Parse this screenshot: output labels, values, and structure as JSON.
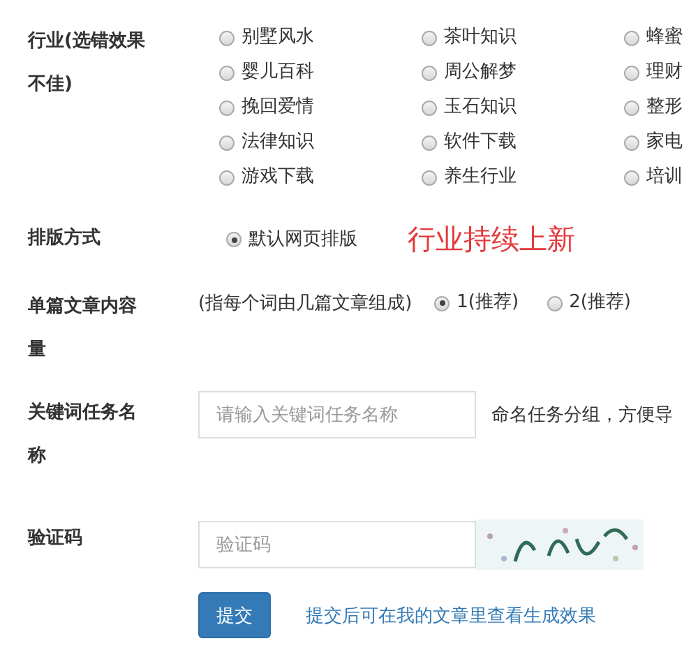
{
  "form": {
    "fields": [
      {
        "kind": "radio_grid",
        "label": "行业(选错效果不佳)",
        "options": [
          {
            "label": "别墅风水",
            "selected": false
          },
          {
            "label": "茶叶知识",
            "selected": false
          },
          {
            "label": "蜂蜜",
            "selected": false
          },
          {
            "label": "婴儿百科",
            "selected": false
          },
          {
            "label": "周公解梦",
            "selected": false
          },
          {
            "label": "理财",
            "selected": false
          },
          {
            "label": "挽回爱情",
            "selected": false
          },
          {
            "label": "玉石知识",
            "selected": false
          },
          {
            "label": "整形",
            "selected": false
          },
          {
            "label": "法律知识",
            "selected": false
          },
          {
            "label": "软件下载",
            "selected": false
          },
          {
            "label": "家电",
            "selected": false
          },
          {
            "label": "游戏下载",
            "selected": false
          },
          {
            "label": "养生行业",
            "selected": false
          },
          {
            "label": "培训",
            "selected": false
          }
        ]
      },
      {
        "kind": "radio_inline",
        "label": "排版方式",
        "options": [
          {
            "label": "默认网页排版",
            "selected": true
          }
        ],
        "notice": "行业持续上新"
      },
      {
        "kind": "radio_inline",
        "label": "单篇文章内容量",
        "hint": "(指每个词由几篇文章组成)",
        "options": [
          {
            "label": "1(推荐)",
            "selected": true
          },
          {
            "label": "2(推荐)",
            "selected": false
          }
        ]
      },
      {
        "kind": "text_input",
        "label": "关键词任务名称",
        "placeholder": "请输入关键词任务名称",
        "hint": "命名任务分组，方便导"
      },
      {
        "kind": "captcha",
        "label": "验证码",
        "placeholder": "验证码"
      }
    ],
    "submit": {
      "label": "提交",
      "note": "提交后可在我的文章里查看生成效果"
    }
  }
}
